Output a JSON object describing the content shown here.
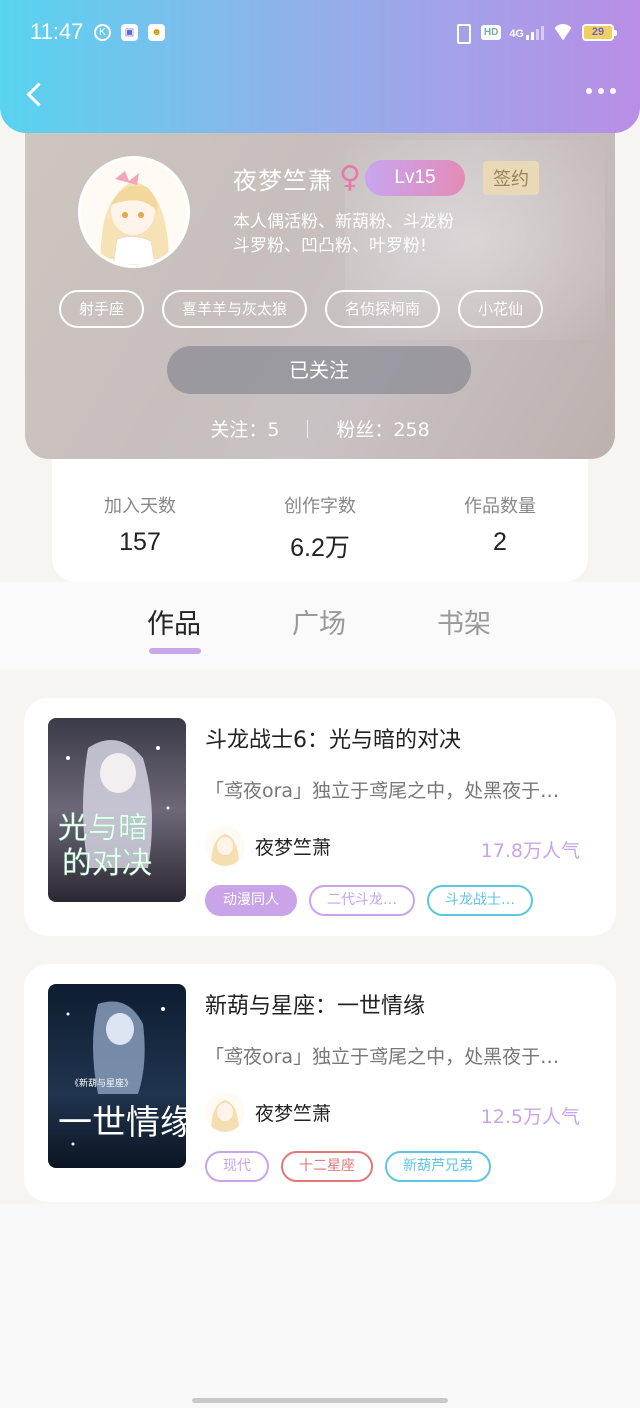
{
  "status_bar": {
    "time": "11:47",
    "icons": [
      "k-icon",
      "store-icon",
      "mascot-icon"
    ],
    "hd": "HD",
    "network": "4G",
    "battery": "29"
  },
  "header": {
    "back_icon": "chevron-left-icon",
    "more_icon": "more-dots-icon"
  },
  "profile": {
    "nickname": "夜梦竺萧",
    "gender_symbol": "♀",
    "level": "Lv15",
    "signed": "签约",
    "bio_line1": "本人偶活粉、新葫粉、斗龙粉",
    "bio_line2": "斗罗粉、凹凸粉、叶罗粉!",
    "tags": [
      "射手座",
      "喜羊羊与灰太狼",
      "名侦探柯南",
      "小花仙"
    ],
    "follow_button": "已关注",
    "following": "关注：5",
    "fans": "粉丝：258"
  },
  "stats": [
    {
      "label": "加入天数",
      "value": "157"
    },
    {
      "label": "创作字数",
      "value": "6.2万"
    },
    {
      "label": "作品数量",
      "value": "2"
    }
  ],
  "tabs": [
    "作品",
    "广场",
    "书架"
  ],
  "works": [
    {
      "title": "斗龙战士6：光与暗的对决",
      "desc": "「鸢夜ora」独立于鸢尾之中，处黑夜于…",
      "author": "夜梦竺萧",
      "popularity": "17.8万人气",
      "tags": [
        {
          "label": "动漫同人",
          "color": "#c9a4e8",
          "filled": true
        },
        {
          "label": "二代斗龙…",
          "color": "#c9a4e8",
          "filled": false
        },
        {
          "label": "斗龙战士…",
          "color": "#5ec6e0",
          "filled": false
        }
      ],
      "cover_text": "光与暗的对决"
    },
    {
      "title": "新葫与星座：一世情缘",
      "desc": "「鸢夜ora」独立于鸢尾之中，处黑夜于…",
      "author": "夜梦竺萧",
      "popularity": "12.5万人气",
      "tags": [
        {
          "label": "现代",
          "color": "#c9a4e8",
          "filled": false
        },
        {
          "label": "十二星座",
          "color": "#e37878",
          "filled": false
        },
        {
          "label": "新葫芦兄弟",
          "color": "#5ec6e0",
          "filled": false
        }
      ],
      "cover_text": "一世情缘"
    }
  ],
  "colors": {
    "accent_purple": "#c9a4e8",
    "header_gradient_start": "#58d3f0",
    "header_gradient_end": "#b98ee6"
  }
}
